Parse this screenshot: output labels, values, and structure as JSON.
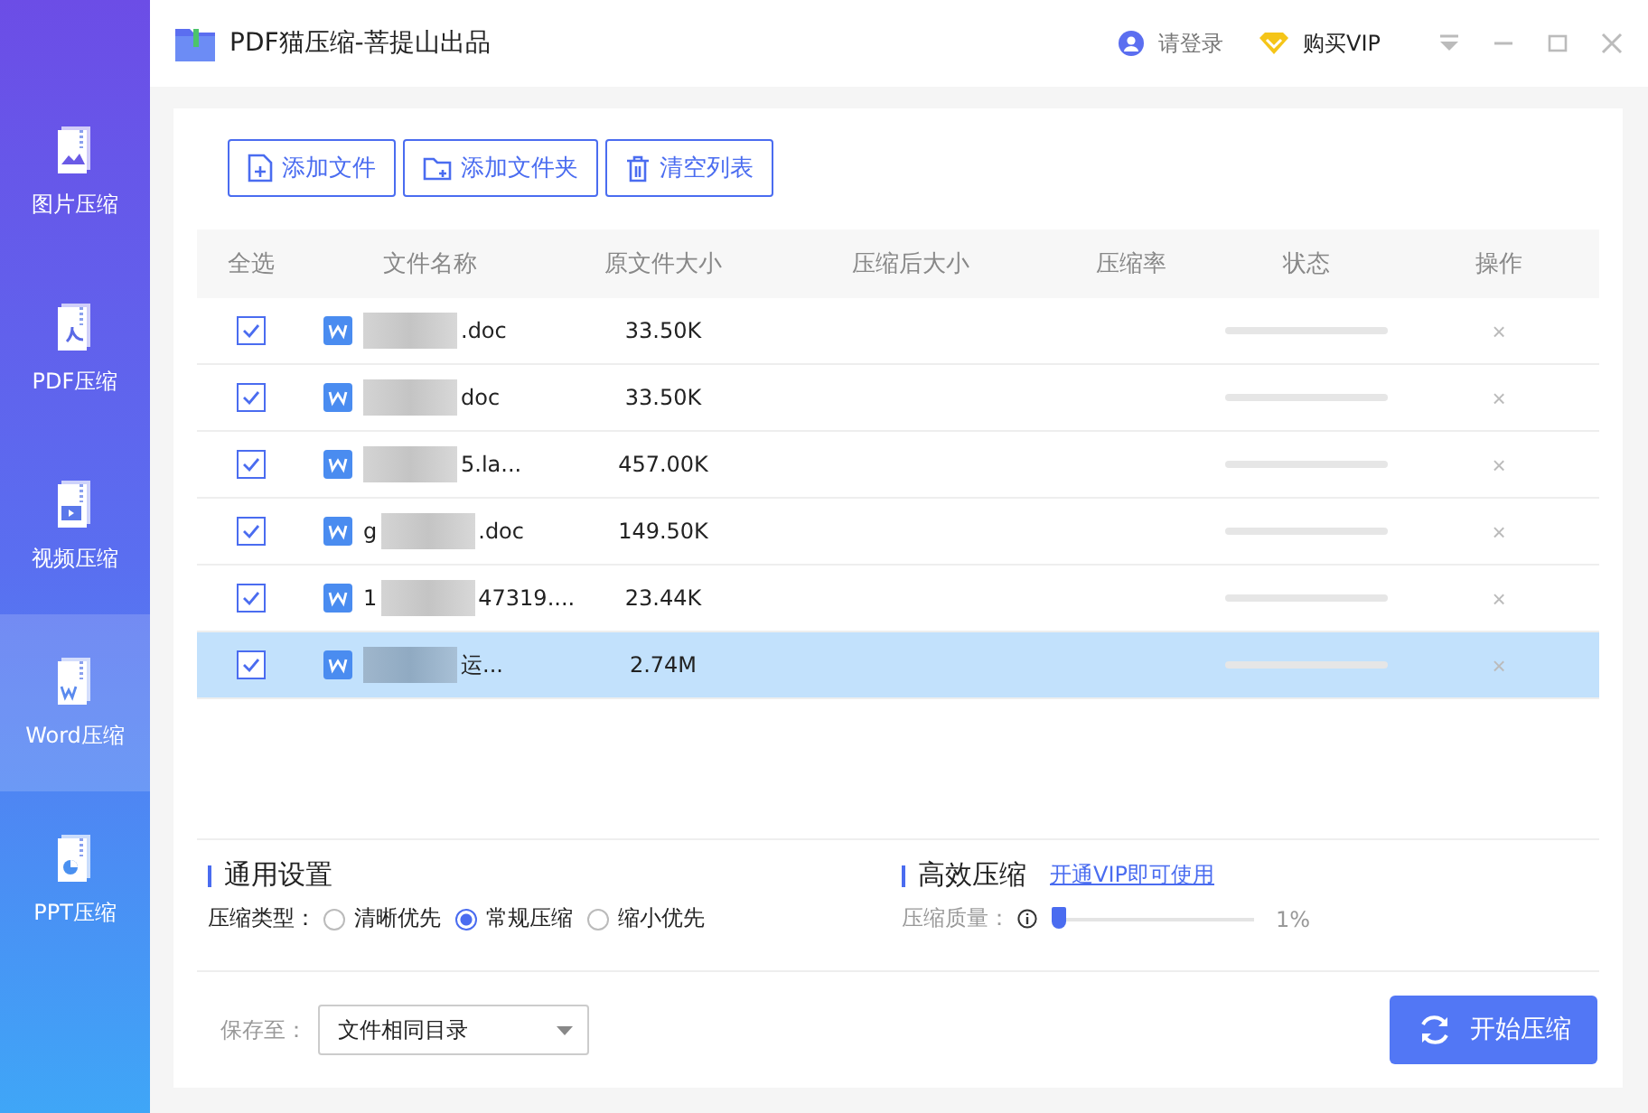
{
  "window": {
    "title": "PDF猫压缩-菩提山出品",
    "login": "请登录",
    "vip": "购买VIP"
  },
  "sidebar": {
    "items": [
      {
        "label": "图片压缩",
        "kind": "image",
        "selected": false
      },
      {
        "label": "PDF压缩",
        "kind": "pdf",
        "selected": false
      },
      {
        "label": "视频压缩",
        "kind": "video",
        "selected": false
      },
      {
        "label": "Word压缩",
        "kind": "word",
        "selected": true
      },
      {
        "label": "PPT压缩",
        "kind": "ppt",
        "selected": false
      }
    ]
  },
  "toolbar": [
    {
      "label": "添加文件",
      "kind": "file"
    },
    {
      "label": "添加文件夹",
      "kind": "folder"
    },
    {
      "label": "清空列表",
      "kind": "trash"
    }
  ],
  "table": {
    "columns": [
      "全选",
      "文件名称",
      "原文件大小",
      "压缩后大小",
      "压缩率",
      "状态",
      "操作"
    ],
    "rows": [
      {
        "checked": true,
        "selected": false,
        "name_start": "",
        "name_end": ".doc",
        "size": "33.50K",
        "remove": "×"
      },
      {
        "checked": true,
        "selected": false,
        "name_start": "",
        "name_end": "doc",
        "size": "33.50K",
        "remove": "×"
      },
      {
        "checked": true,
        "selected": false,
        "name_start": "",
        "name_end": "5.la...",
        "size": "457.00K",
        "remove": "×"
      },
      {
        "checked": true,
        "selected": false,
        "name_start": "g",
        "name_end": ".doc",
        "size": "149.50K",
        "remove": "×"
      },
      {
        "checked": true,
        "selected": false,
        "name_start": "1",
        "name_end": "47319....",
        "size": "23.44K",
        "remove": "×"
      },
      {
        "checked": true,
        "selected": true,
        "name_start": "",
        "name_end": "运...",
        "size": "2.74M",
        "remove": "×"
      }
    ]
  },
  "settings": {
    "title": "通用设置",
    "type_label": "压缩类型：",
    "options": [
      {
        "label": "清晰优先",
        "selected": false
      },
      {
        "label": "常规压缩",
        "selected": true
      },
      {
        "label": "缩小优先",
        "selected": false
      }
    ]
  },
  "efficient": {
    "title": "高效压缩",
    "link": "开通VIP即可使用",
    "quality_label": "压缩质量：",
    "quality": {
      "level": 0.01
    },
    "reading": "1%"
  },
  "save": {
    "label": "保存至：",
    "value": "文件相同目录"
  },
  "start_button": "开始压缩"
}
